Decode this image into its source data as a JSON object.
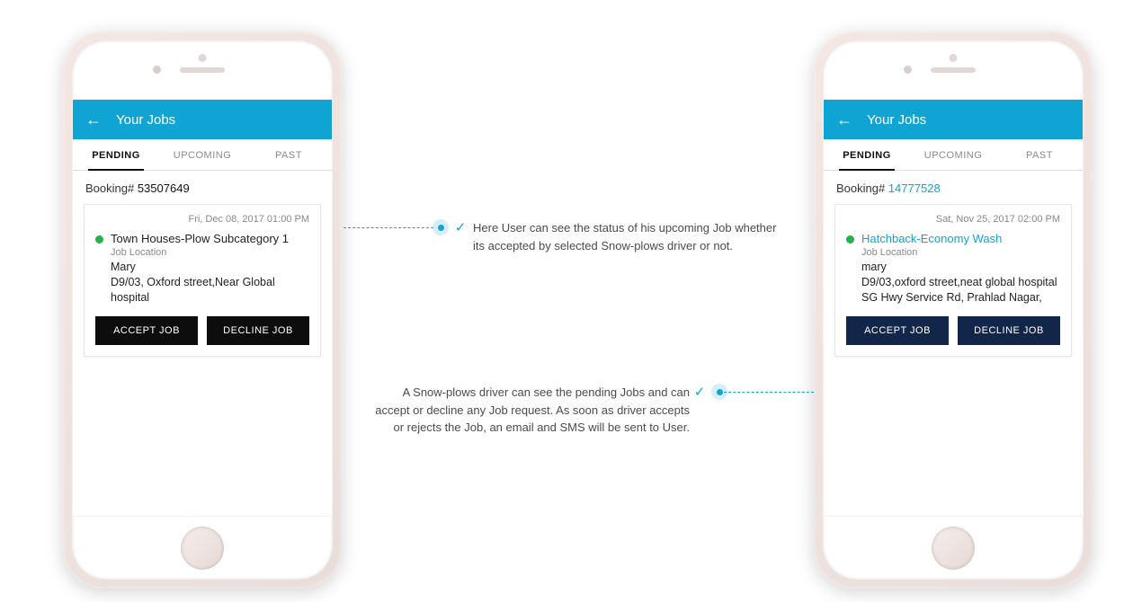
{
  "header": {
    "title": "Your Jobs"
  },
  "tabs": {
    "pending": "PENDING",
    "upcoming": "UPCOMING",
    "past": "PAST"
  },
  "buttons": {
    "accept": "ACCEPT JOB",
    "decline": "DECLINE JOB"
  },
  "labels": {
    "booking_prefix": "Booking# ",
    "job_location": "Job Location"
  },
  "left": {
    "booking_id": "53507649",
    "date": "Fri, Dec 08, 2017 01:00 PM",
    "service": "Town Houses-Plow Subcategory 1",
    "customer": "Mary",
    "address": "D9/03, Oxford street,Near Global hospital"
  },
  "right": {
    "booking_id": "14777528",
    "date": "Sat, Nov 25, 2017 02:00 PM",
    "service": "Hatchback-Economy Wash",
    "customer": "mary",
    "address": "D9/03,oxford street,neat global hospital SG Hwy Service Rd, Prahlad Nagar,"
  },
  "annotations": {
    "a1": "Here User can see the status of his upcoming Job whether its accepted by selected Snow-plows driver or not.",
    "a2": "A Snow-plows driver can see the pending Jobs and can accept or decline any Job request. As soon as driver accepts or rejects the Job, an email and SMS will be sent to User."
  },
  "colors": {
    "accent": "#0fa4d3"
  }
}
